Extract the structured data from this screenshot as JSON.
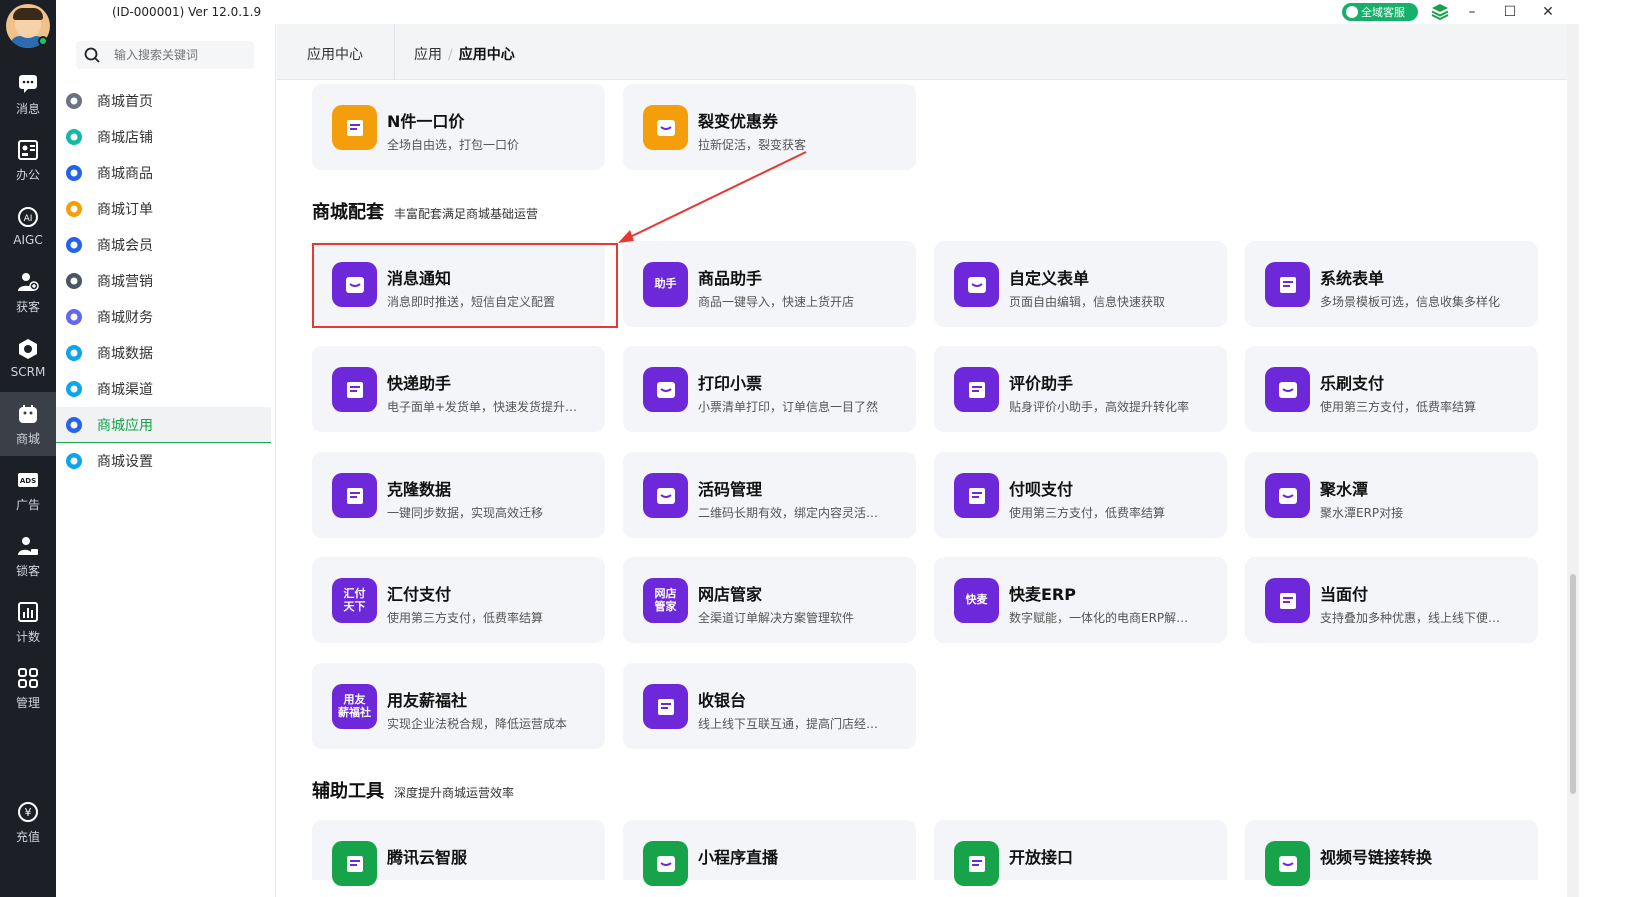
{
  "window": {
    "version": "(ID-000001)  Ver 12.0.1.9",
    "service_label": "全域客服",
    "minimize": "–",
    "maximize": "☐",
    "close": "✕"
  },
  "leftnav": [
    {
      "label": "消息",
      "icon": "chat-icon"
    },
    {
      "label": "办公",
      "icon": "office-icon"
    },
    {
      "label": "AIGC",
      "icon": "ai-icon"
    },
    {
      "label": "获客",
      "icon": "user-add-icon"
    },
    {
      "label": "SCRM",
      "icon": "scrm-icon"
    },
    {
      "label": "商城",
      "icon": "mall-icon"
    },
    {
      "label": "广告",
      "icon": "ads-icon"
    },
    {
      "label": "锁客",
      "icon": "lock-user-icon"
    },
    {
      "label": "计数",
      "icon": "bar-chart-icon"
    },
    {
      "label": "管理",
      "icon": "grid-icon"
    },
    {
      "label": "充值",
      "icon": "yuan-icon"
    }
  ],
  "sidebar": {
    "search_placeholder": "输入搜索关键词",
    "items": [
      {
        "label": "商城首页",
        "color": "#6b7280"
      },
      {
        "label": "商城店铺",
        "color": "#14b8a6"
      },
      {
        "label": "商城商品",
        "color": "#2563eb"
      },
      {
        "label": "商城订单",
        "color": "#f59e0b"
      },
      {
        "label": "商城会员",
        "color": "#2563eb"
      },
      {
        "label": "商城营销",
        "color": "#4b5563"
      },
      {
        "label": "商城财务",
        "color": "#6366f1"
      },
      {
        "label": "商城数据",
        "color": "#0ea5e9"
      },
      {
        "label": "商城渠道",
        "color": "#0ea5e9"
      },
      {
        "label": "商城应用",
        "color": "#2563eb"
      },
      {
        "label": "商城设置",
        "color": "#0ea5e9"
      }
    ]
  },
  "breadcrumb": {
    "app": "应用中心",
    "parent": "应用",
    "separator": "/",
    "current": "应用中心"
  },
  "top_cards": [
    {
      "title": "N件一口价",
      "desc": "全场自由选，打包一口价"
    },
    {
      "title": "裂变优惠券",
      "desc": "拉新促活，裂变获客"
    }
  ],
  "section_mall": {
    "title": "商城配套",
    "subtitle": "丰富配套满足商城基础运营"
  },
  "mall_cards": [
    {
      "title": "消息通知",
      "desc": "消息即时推送，短信自定义配置",
      "icon_text": ""
    },
    {
      "title": "商品助手",
      "desc": "商品一键导入，快速上货开店",
      "icon_text": "助手"
    },
    {
      "title": "自定义表单",
      "desc": "页面自由编辑，信息快速获取",
      "icon_text": ""
    },
    {
      "title": "系统表单",
      "desc": "多场景模板可选，信息收集多样化",
      "icon_text": ""
    },
    {
      "title": "快递助手",
      "desc": "电子面单+发货单，快速发货提升…",
      "icon_text": ""
    },
    {
      "title": "打印小票",
      "desc": "小票清单打印，订单信息一目了然",
      "icon_text": ""
    },
    {
      "title": "评价助手",
      "desc": "贴身评价小助手，高效提升转化率",
      "icon_text": ""
    },
    {
      "title": "乐刷支付",
      "desc": "使用第三方支付，低费率结算",
      "icon_text": ""
    },
    {
      "title": "克隆数据",
      "desc": "一键同步数据，实现高效迁移",
      "icon_text": ""
    },
    {
      "title": "活码管理",
      "desc": "二维码长期有效，绑定内容灵活…",
      "icon_text": ""
    },
    {
      "title": "付呗支付",
      "desc": "使用第三方支付，低费率结算",
      "icon_text": ""
    },
    {
      "title": "聚水潭",
      "desc": "聚水潭ERP对接",
      "icon_text": ""
    },
    {
      "title": "汇付支付",
      "desc": "使用第三方支付，低费率结算",
      "icon_text": "汇付\n天下"
    },
    {
      "title": "网店管家",
      "desc": "全渠道订单解决方案管理软件",
      "icon_text": "网店\n管家"
    },
    {
      "title": "快麦ERP",
      "desc": "数字赋能，一体化的电商ERP解…",
      "icon_text": "快麦"
    },
    {
      "title": "当面付",
      "desc": "支持叠加多种优惠，线上线下便…",
      "icon_text": ""
    },
    {
      "title": "用友薪福社",
      "desc": "实现企业法税合规，降低运营成本",
      "icon_text": "用友\n薪福社"
    },
    {
      "title": "收银台",
      "desc": "线上线下互联互通，提高门店经…",
      "icon_text": ""
    }
  ],
  "section_tools": {
    "title": "辅助工具",
    "subtitle": "深度提升商城运营效率"
  },
  "tool_cards": [
    {
      "title": "腾讯云智服"
    },
    {
      "title": "小程序直播"
    },
    {
      "title": "开放接口"
    },
    {
      "title": "视频号链接转换"
    }
  ],
  "colors": {
    "accent": "#6d28d9",
    "active_green": "#16a34a",
    "highlight_red": "#e53935"
  }
}
